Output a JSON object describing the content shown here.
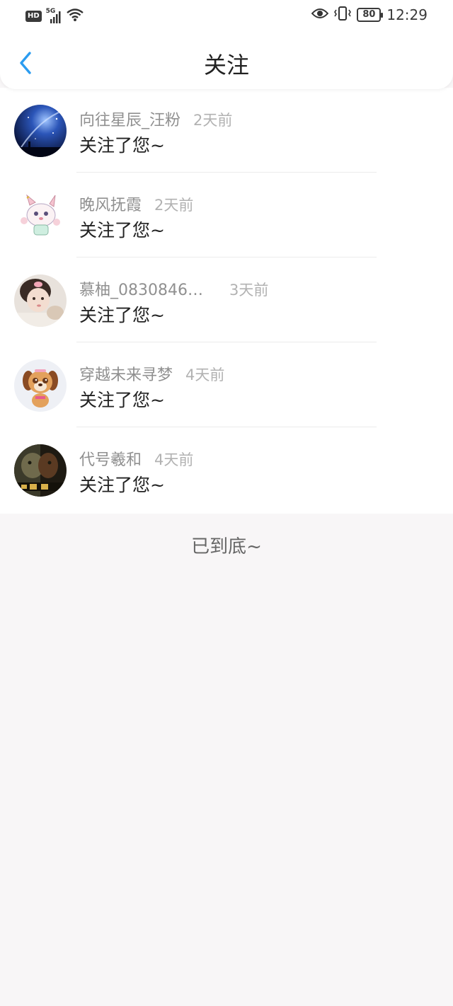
{
  "status_bar": {
    "hd": "HD",
    "network": "5G",
    "battery": "80",
    "time": "12:29"
  },
  "header": {
    "title": "关注",
    "back_icon": "chevron-left-icon"
  },
  "notifications": [
    {
      "name": "向往星辰_汪粉",
      "time": "2天前",
      "message": "关注了您~"
    },
    {
      "name": "晚风抚霞",
      "time": "2天前",
      "message": "关注了您~"
    },
    {
      "name": "慕柚_08308466...",
      "time": "3天前",
      "message": "关注了您~"
    },
    {
      "name": "穿越未来寻梦",
      "time": "4天前",
      "message": "关注了您~"
    },
    {
      "name": "代号羲和",
      "time": "4天前",
      "message": "关注了您~"
    }
  ],
  "footer": {
    "end_text": "已到底~"
  },
  "colors": {
    "accent": "#2b9cf0",
    "background": "#f8f6f7"
  }
}
